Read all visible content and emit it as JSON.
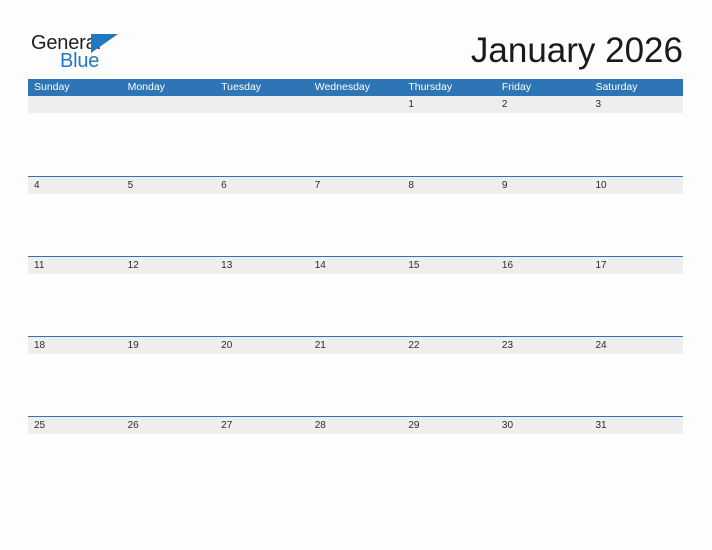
{
  "brand": {
    "name_part1": "General",
    "name_part2": "Blue",
    "triangle_icon": "brand-triangle-icon",
    "accent_color": "#1f78c1",
    "text_color": "#231f20"
  },
  "header": {
    "title": "January 2026",
    "month": "January",
    "year": "2026"
  },
  "calendar": {
    "header_bg_color": "#2e75b6",
    "date_band_color": "#eeeeee",
    "rule_color": "#2e75b6",
    "weekdays": [
      "Sunday",
      "Monday",
      "Tuesday",
      "Wednesday",
      "Thursday",
      "Friday",
      "Saturday"
    ],
    "weeks": [
      [
        "",
        "",
        "",
        "",
        "1",
        "2",
        "3"
      ],
      [
        "4",
        "5",
        "6",
        "7",
        "8",
        "9",
        "10"
      ],
      [
        "11",
        "12",
        "13",
        "14",
        "15",
        "16",
        "17"
      ],
      [
        "18",
        "19",
        "20",
        "21",
        "22",
        "23",
        "24"
      ],
      [
        "25",
        "26",
        "27",
        "28",
        "29",
        "30",
        "31"
      ]
    ]
  }
}
